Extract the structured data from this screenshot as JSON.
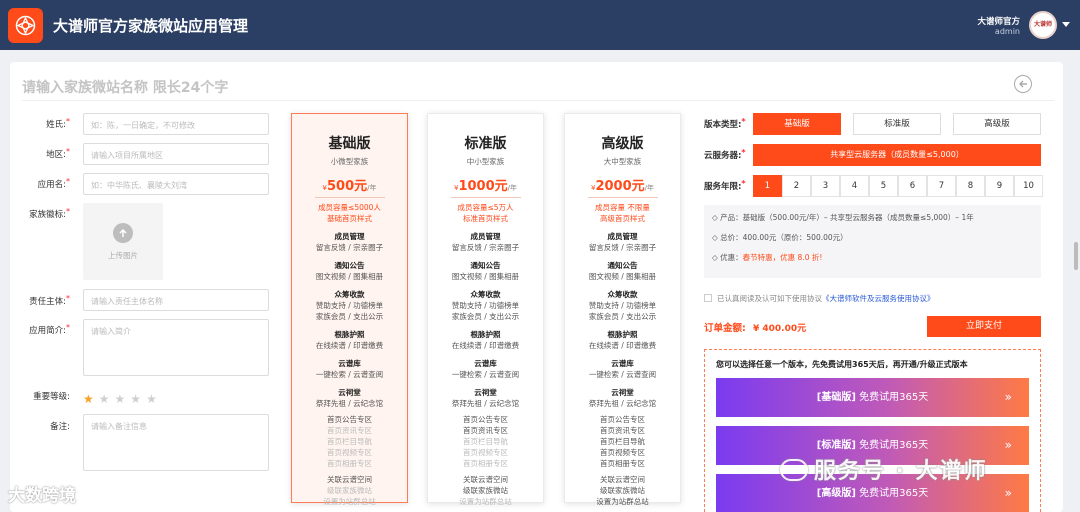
{
  "header": {
    "title": "大谱师官方家族微站应用管理",
    "user_name": "大谱师官方",
    "user_role": "admin",
    "avatar_text": "大谱师"
  },
  "name_input": {
    "placeholder": "请输入家族微站名称 限长24个字"
  },
  "form": {
    "surname": {
      "label": "姓氏:",
      "placeholder": "如：陈，一日确定，不可修改"
    },
    "region": {
      "label": "地区:",
      "placeholder": "请输入项目所属地区"
    },
    "app_name": {
      "label": "应用名:",
      "placeholder": "如：中华陈氏、襄陵大刘湾"
    },
    "emblem": {
      "label": "家族徽标:",
      "upload_text": "上传图片"
    },
    "owner": {
      "label": "责任主体:",
      "placeholder": "请输入责任主体名称"
    },
    "intro": {
      "label": "应用简介:",
      "placeholder": "请输入简介"
    },
    "importance": {
      "label": "重要等级:",
      "rating": 1,
      "max": 5
    },
    "remark": {
      "label": "备注:",
      "placeholder": "请输入备注信息"
    }
  },
  "plans": [
    {
      "title": "基础版",
      "subtitle": "小微型家族",
      "currency": "¥",
      "price": "500元",
      "unit": "/年",
      "cap1": "成员容量≤5000人",
      "cap2": "基础首页样式",
      "features": [
        {
          "h": "成员管理",
          "d": "留言反馈 / 宗亲圈子"
        },
        {
          "h": "通知公告",
          "d": "图文视频 / 图集相册"
        },
        {
          "h": "众筹收款",
          "d": "赞助支持 / 功德榜单",
          "d2": "家族会员 / 支出公示"
        },
        {
          "h": "根脉护照",
          "d": "在线续谱 / 印谱缴费"
        },
        {
          "h": "云谱库",
          "d": "一键检索 / 云谱查阅"
        },
        {
          "h": "云祠堂",
          "d": "祭拜先祖 / 云纪念馆"
        }
      ],
      "home": [
        "首页公告专区",
        "首页资讯专区",
        "首页栏目导航",
        "首页视频专区",
        "首页相册专区"
      ],
      "extra": [
        "关联云谱空间",
        "级联家族微站",
        "设置为站群总站"
      ]
    },
    {
      "title": "标准版",
      "subtitle": "中小型家族",
      "currency": "¥",
      "price": "1000元",
      "unit": "/年",
      "cap1": "成员容量≤5万人",
      "cap2": "标准首页样式",
      "features": [
        {
          "h": "成员管理",
          "d": "留言反馈 / 宗亲圈子"
        },
        {
          "h": "通知公告",
          "d": "图文视频 / 图集相册"
        },
        {
          "h": "众筹收款",
          "d": "赞助支持 / 功德榜单",
          "d2": "家族会员 / 支出公示"
        },
        {
          "h": "根脉护照",
          "d": "在线续谱 / 印谱缴费"
        },
        {
          "h": "云谱库",
          "d": "一键检索 / 云谱查阅"
        },
        {
          "h": "云祠堂",
          "d": "祭拜先祖 / 云纪念馆"
        }
      ],
      "home": [
        "首页公告专区",
        "首页资讯专区",
        "首页栏目导航",
        "首页视频专区",
        "首页相册专区"
      ],
      "extra": [
        "关联云谱空间",
        "级联家族微站",
        "设置为站群总站"
      ]
    },
    {
      "title": "高级版",
      "subtitle": "大中型家族",
      "currency": "¥",
      "price": "2000元",
      "unit": "/年",
      "cap1": "成员容量 不限量",
      "cap2": "高级首页样式",
      "features": [
        {
          "h": "成员管理",
          "d": "留言反馈 / 宗亲圈子"
        },
        {
          "h": "通知公告",
          "d": "图文视频 / 图集相册"
        },
        {
          "h": "众筹收款",
          "d": "赞助支持 / 功德榜单",
          "d2": "家族会员 / 支出公示"
        },
        {
          "h": "根脉护照",
          "d": "在线续谱 / 印谱缴费"
        },
        {
          "h": "云谱库",
          "d": "一键检索 / 云谱查阅"
        },
        {
          "h": "云祠堂",
          "d": "祭拜先祖 / 云纪念馆"
        }
      ],
      "home": [
        "首页公告专区",
        "首页资讯专区",
        "首页栏目导航",
        "首页视频专区",
        "首页相册专区"
      ],
      "extra": [
        "关联云谱空间",
        "级联家族微站",
        "设置为站群总站"
      ]
    }
  ],
  "config": {
    "version_label": "版本类型:",
    "versions": [
      "基础版",
      "标准版",
      "高级版"
    ],
    "cloud_label": "云服务器:",
    "cloud_value": "共享型云服务器（成员数量≤5,000）",
    "years_label": "服务年限:",
    "years": [
      "1",
      "2",
      "3",
      "4",
      "5",
      "6",
      "7",
      "8",
      "9",
      "10"
    ],
    "summary_product": "◇ 产品：基础版（500.00元/年）– 共享型云服务器（成员数量≤5,000）– 1年",
    "summary_total": "◇ 总价：400.00元（原价：500.00元）",
    "summary_discount_prefix": "◇ 优惠：",
    "summary_discount": "春节特惠，优惠 8.0 折!",
    "agree_text": "已认真阅读及认可如下使用协议",
    "agree_link": "《大谱师软件及云服务使用协议》",
    "order_label": "订单金额:",
    "order_amount": "¥ 400.00元",
    "pay_button": "立即支付",
    "trial_note": "您可以选择任意一个版本，先免费试用365天后，再开通/升级正式版本",
    "trials": [
      {
        "tier": "[基础版]",
        "text": " 免费试用365天"
      },
      {
        "tier": "[标准版]",
        "text": " 免费试用365天"
      },
      {
        "tier": "[高级版]",
        "text": " 免费试用365天"
      }
    ]
  },
  "watermarks": {
    "left": "大数跨境",
    "right": "服务号 · 大谱师"
  },
  "colors": {
    "accent": "#ff4a1a",
    "header": "#2b3e63",
    "star": "#f7a12b"
  }
}
